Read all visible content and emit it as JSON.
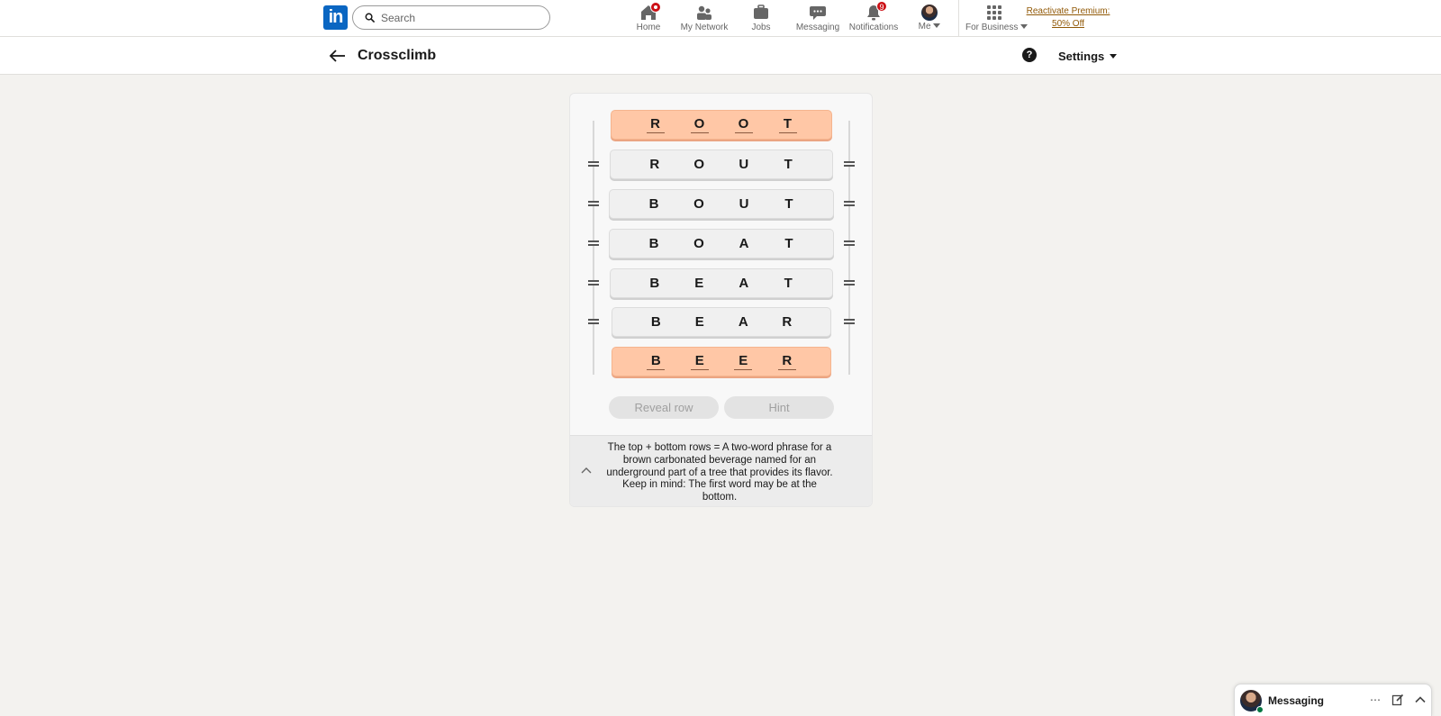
{
  "nav": {
    "logo": "in",
    "search_placeholder": "Search",
    "items": [
      {
        "label": "Home",
        "icon": "home-icon",
        "badge": ""
      },
      {
        "label": "My Network",
        "icon": "network-icon",
        "badge": ""
      },
      {
        "label": "Jobs",
        "icon": "briefcase-icon",
        "badge": ""
      },
      {
        "label": "Messaging",
        "icon": "chat-icon",
        "badge": ""
      },
      {
        "label": "Notifications",
        "icon": "bell-icon",
        "badge": "9"
      },
      {
        "label": "Me",
        "icon": "avatar",
        "badge": ""
      },
      {
        "label": "For Business",
        "icon": "grid-icon",
        "badge": ""
      }
    ],
    "premium_line1": "Reactivate Premium:",
    "premium_line2": "50% Off"
  },
  "header": {
    "title": "Crossclimb",
    "settings_label": "Settings"
  },
  "game": {
    "rows": [
      {
        "letters": [
          "R",
          "O",
          "O",
          "T"
        ],
        "locked": true
      },
      {
        "letters": [
          "R",
          "O",
          "U",
          "T"
        ],
        "locked": false
      },
      {
        "letters": [
          "B",
          "O",
          "U",
          "T"
        ],
        "locked": false
      },
      {
        "letters": [
          "B",
          "O",
          "A",
          "T"
        ],
        "locked": false
      },
      {
        "letters": [
          "B",
          "E",
          "A",
          "T"
        ],
        "locked": false
      },
      {
        "letters": [
          "B",
          "E",
          "A",
          "R"
        ],
        "locked": false
      },
      {
        "letters": [
          "B",
          "E",
          "E",
          "R"
        ],
        "locked": true
      }
    ],
    "reveal_label": "Reveal row",
    "hint_label": "Hint",
    "clue": "The top + bottom rows = A two-word phrase for a brown carbonated beverage named for an underground part of a tree that provides its flavor. Keep in mind: The first word may be at the bottom."
  },
  "messaging": {
    "label": "Messaging"
  },
  "colors": {
    "brand": "#0a66c2",
    "end_row": "#ffc7a6",
    "badge": "#cc1016",
    "premium_link": "#915907"
  }
}
